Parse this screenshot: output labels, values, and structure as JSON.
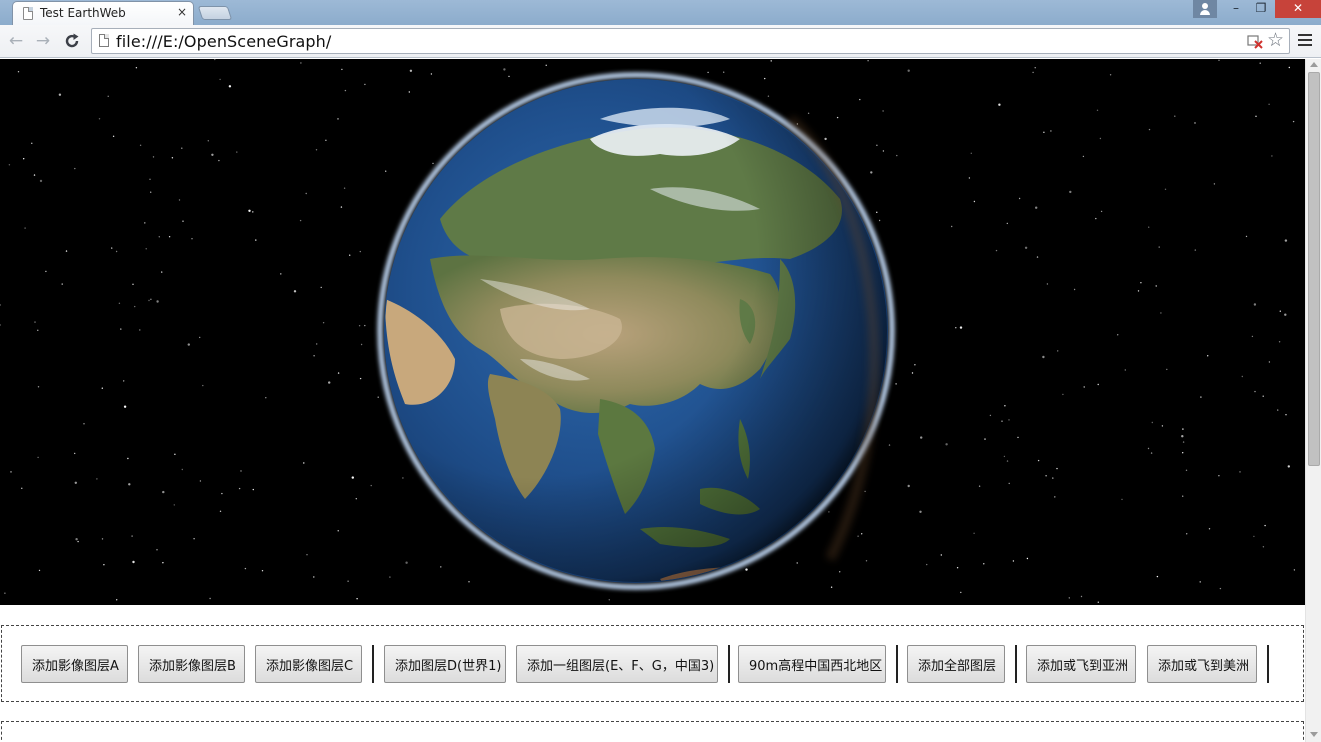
{
  "browser": {
    "tab_title": "Test EarthWeb",
    "tab_close": "×",
    "url": "file:///E:/OpenSceneGraph/",
    "icons": {
      "back": "back-arrow-icon",
      "forward": "forward-arrow-icon",
      "reload": "reload-icon",
      "page": "page-icon",
      "plugin_blocked": "plugin-blocked-icon",
      "bookmark": "star-icon",
      "menu": "hamburger-menu-icon",
      "user": "user-icon"
    },
    "window_controls": {
      "minimize": "–",
      "maximize": "❐",
      "close": "✕"
    }
  },
  "scene": {
    "type": "3d-earth-globe",
    "background": "starfield",
    "view_center": "Asia"
  },
  "toolbar_buttons": [
    {
      "label": "添加影像图层A"
    },
    {
      "label": "添加影像图层B"
    },
    {
      "label": "添加影像图层C"
    },
    {
      "label": "添加图层D(世界1)"
    },
    {
      "label": "添加一组图层(E、F、G，中国3)"
    },
    {
      "label": "90m高程中国西北地区"
    },
    {
      "label": "添加全部图层"
    },
    {
      "label": "添加或飞到亚洲"
    },
    {
      "label": "添加或飞到美洲"
    }
  ],
  "colors": {
    "titlebar": "#9db9d6",
    "close_button": "#c7433a",
    "space": "#000000",
    "ocean": "#1e4f8a",
    "atmosphere": "#9fc8ff"
  }
}
